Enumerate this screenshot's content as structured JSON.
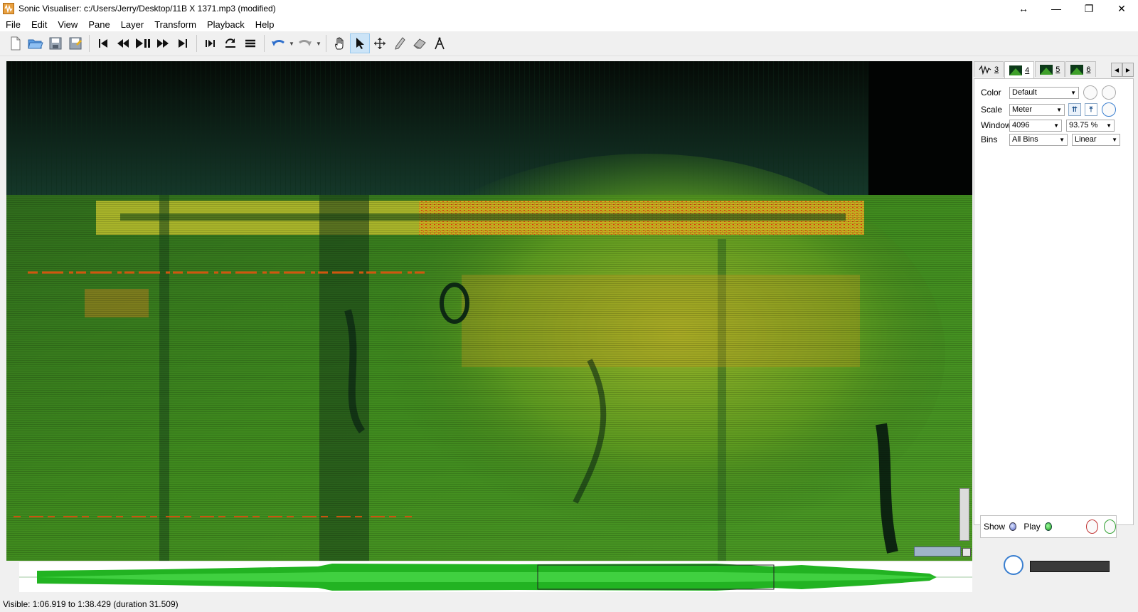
{
  "window": {
    "title": "Sonic Visualiser: c:/Users/Jerry/Desktop/11B X 1371.mp3 (modified)",
    "controls": [
      "↔",
      "—",
      "❐",
      "✕"
    ]
  },
  "menu": [
    "File",
    "Edit",
    "View",
    "Pane",
    "Layer",
    "Transform",
    "Playback",
    "Help"
  ],
  "toolbar": {
    "icons": [
      "new-file-icon",
      "open-file-icon",
      "save-icon",
      "save-as-icon",
      "rewind-start-icon",
      "rewind-icon",
      "play-pause-icon",
      "fast-forward-icon",
      "fast-forward-end-icon",
      "play-selection-icon",
      "loop-icon",
      "solo-icon",
      "undo-icon",
      "redo-icon",
      "navigate-hand-icon",
      "select-arrow-icon",
      "move-icon",
      "draw-pencil-icon",
      "erase-icon",
      "measure-icon"
    ],
    "active_tool": "select-arrow-icon"
  },
  "tabs": [
    {
      "label": "3",
      "kind": "waveform"
    },
    {
      "label": "4",
      "kind": "spectrogram",
      "active": true
    },
    {
      "label": "5",
      "kind": "spectrogram"
    },
    {
      "label": "6",
      "kind": "spectrogram"
    }
  ],
  "properties": {
    "color_label": "Color",
    "color_value": "Default",
    "scale_label": "Scale",
    "scale_value": "Meter",
    "window_label": "Window",
    "window_value": "4096",
    "overlap_value": "93.75 %",
    "bins_label": "Bins",
    "bins_value": "All Bins",
    "bins_scale_value": "Linear"
  },
  "layer": {
    "show_label": "Show",
    "play_label": "Play"
  },
  "status": {
    "visible": "Visible: 1:06.919 to 1:38.429 (duration 31.509)"
  },
  "colors": {
    "spectrogram_dark": "#0c1a10",
    "spectrogram_green": "#3f8a1e",
    "spectrogram_yellow": "#c8c030",
    "spectrogram_red": "#e03010",
    "overview_green": "#22b322"
  }
}
